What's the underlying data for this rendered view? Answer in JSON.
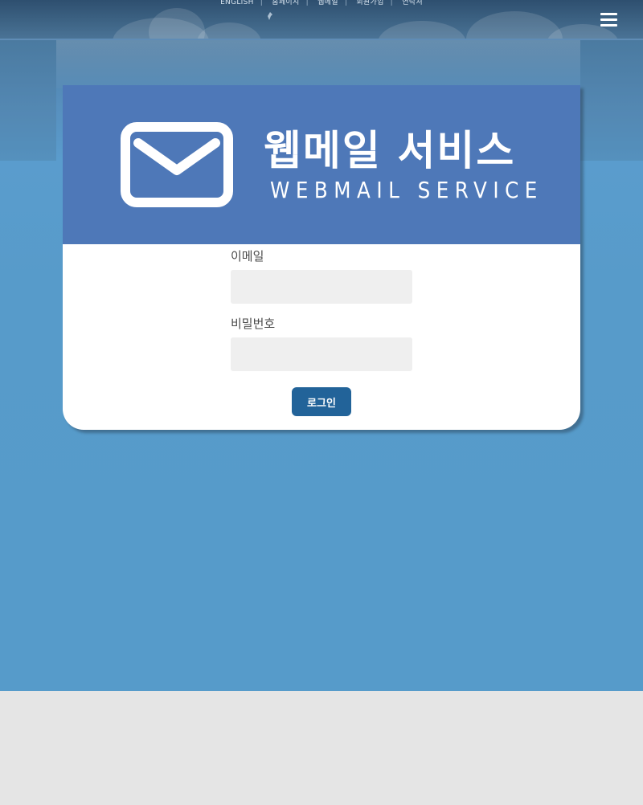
{
  "header": {
    "top_links": [
      "ENGLISH",
      "홈페이지",
      "웹메일",
      "회원가입",
      "연락처"
    ],
    "menu_icon": "hamburger-menu-icon"
  },
  "banner": {
    "title_ko": "웹메일 서비스",
    "title_en": "WEBMAIL SERVICE",
    "icon": "envelope-icon",
    "color": "#4e78b8"
  },
  "login_form": {
    "email_label": "이메일",
    "email_value": "",
    "password_label": "비밀번호",
    "password_value": "",
    "login_button_label": "로그인"
  },
  "colors": {
    "page_background": "#569bca",
    "button": "#226399",
    "input_background": "#efefef",
    "footer": "#e5e5e5"
  }
}
